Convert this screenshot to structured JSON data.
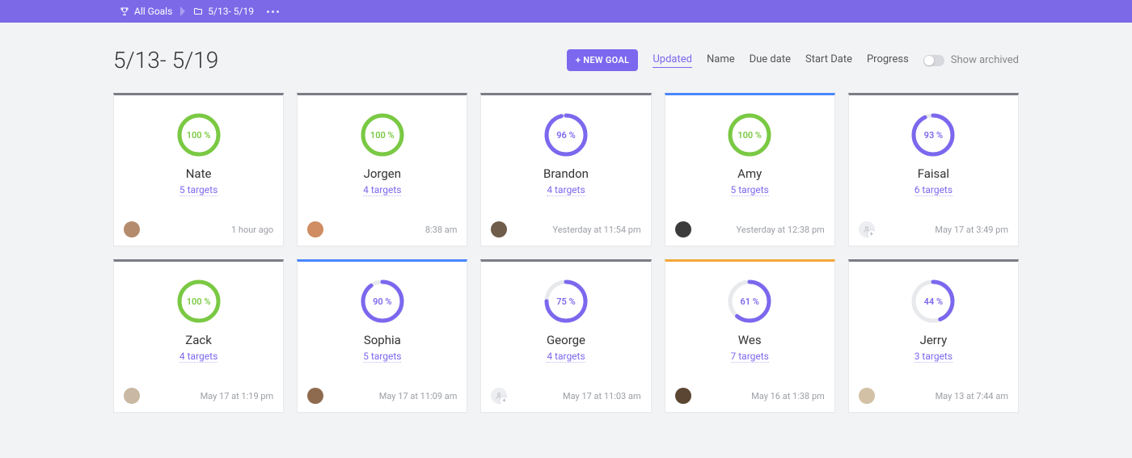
{
  "breadcrumb": {
    "root": "All Goals",
    "folder": "5/13- 5/19"
  },
  "page": {
    "title": "5/13- 5/19"
  },
  "controls": {
    "new_goal": "+ NEW GOAL",
    "sort_options": [
      "Updated",
      "Name",
      "Due date",
      "Start Date",
      "Progress"
    ],
    "active_sort": "Updated",
    "show_archived_label": "Show archived",
    "show_archived_on": false
  },
  "colors": {
    "green": "#7ac943",
    "purple": "#7b68ee",
    "blue": "#4a86ff",
    "orange": "#f2a73b",
    "grey": "#7a7d85",
    "ring_bg": "#e8e9ec"
  },
  "cards": [
    {
      "name": "Nate",
      "percent": 100,
      "ring": "green",
      "accent": "grey",
      "targets": "5 targets",
      "time": "1 hour ago",
      "avatar": "photo",
      "avatar_bg": "#b58b6e"
    },
    {
      "name": "Jorgen",
      "percent": 100,
      "ring": "green",
      "accent": "grey",
      "targets": "4 targets",
      "time": "8:38 am",
      "avatar": "photo",
      "avatar_bg": "#d08c63"
    },
    {
      "name": "Brandon",
      "percent": 96,
      "ring": "purple",
      "accent": "grey",
      "targets": "4 targets",
      "time": "Yesterday at 11:54 pm",
      "avatar": "photo",
      "avatar_bg": "#6f5c4a"
    },
    {
      "name": "Amy",
      "percent": 100,
      "ring": "green",
      "accent": "blue",
      "targets": "5 targets",
      "time": "Yesterday at 12:38 pm",
      "avatar": "photo",
      "avatar_bg": "#3b3b3b"
    },
    {
      "name": "Faisal",
      "percent": 93,
      "ring": "purple",
      "accent": "grey",
      "targets": "6 targets",
      "time": "May 17 at 3:49 pm",
      "avatar": "plus",
      "avatar_bg": "#eceef1"
    },
    {
      "name": "Zack",
      "percent": 100,
      "ring": "green",
      "accent": "grey",
      "targets": "4 targets",
      "time": "May 17 at 1:19 pm",
      "avatar": "photo",
      "avatar_bg": "#c9b8a3"
    },
    {
      "name": "Sophia",
      "percent": 90,
      "ring": "purple",
      "accent": "blue",
      "targets": "5 targets",
      "time": "May 17 at 11:09 am",
      "avatar": "photo",
      "avatar_bg": "#8e6b4f"
    },
    {
      "name": "George",
      "percent": 75,
      "ring": "purple",
      "accent": "grey",
      "targets": "4 targets",
      "time": "May 17 at 11:03 am",
      "avatar": "plus",
      "avatar_bg": "#eceef1"
    },
    {
      "name": "Wes",
      "percent": 61,
      "ring": "purple",
      "accent": "orange",
      "targets": "7 targets",
      "time": "May 16 at 1:38 pm",
      "avatar": "photo",
      "avatar_bg": "#5a4633"
    },
    {
      "name": "Jerry",
      "percent": 44,
      "ring": "purple",
      "accent": "grey",
      "targets": "3 targets",
      "time": "May 13 at 7:44 am",
      "avatar": "photo",
      "avatar_bg": "#d2c1a5"
    }
  ]
}
